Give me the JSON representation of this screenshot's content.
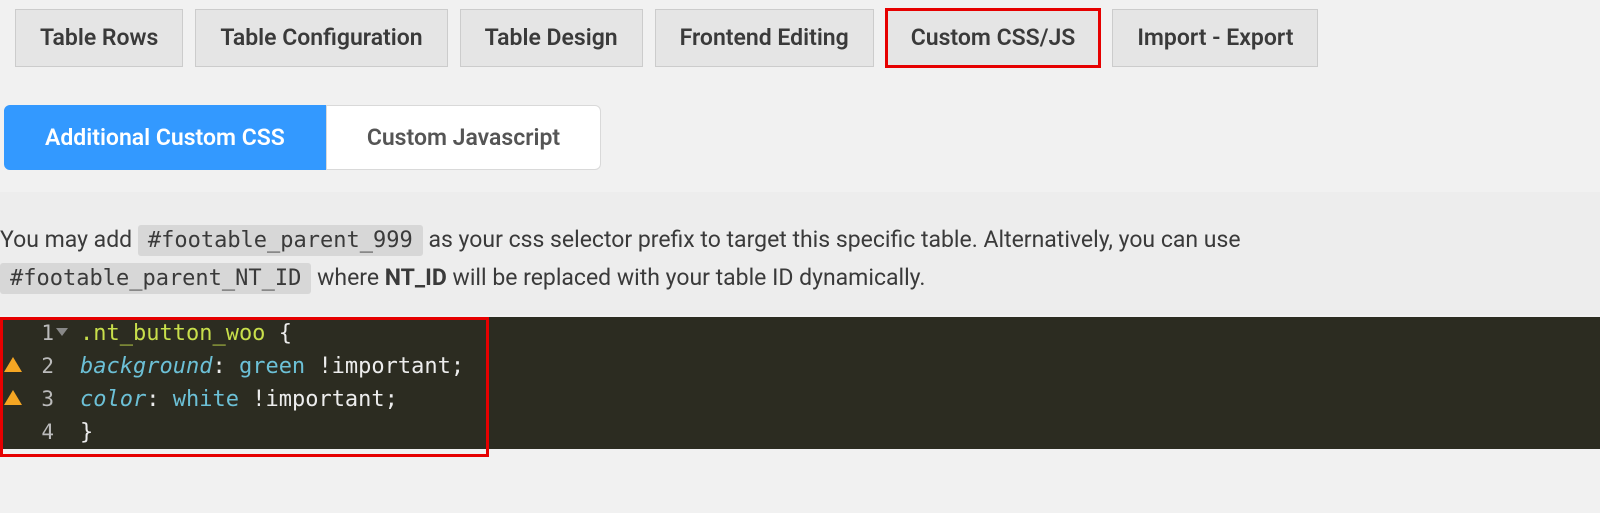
{
  "top_tabs": [
    {
      "label": "Table Rows"
    },
    {
      "label": "Table Configuration"
    },
    {
      "label": "Table Design"
    },
    {
      "label": "Frontend Editing"
    },
    {
      "label": "Custom CSS/JS",
      "highlighted": true
    },
    {
      "label": "Import - Export"
    }
  ],
  "sub_tabs": [
    {
      "label": "Additional Custom CSS",
      "active": true
    },
    {
      "label": "Custom Javascript"
    }
  ],
  "help": {
    "pre1": "You may add ",
    "chip1": "#footable_parent_999",
    "mid1": " as your css selector prefix to target this specific table. Alternatively, you can use",
    "chip2": "#footable_parent_NT_ID",
    "mid2": " where ",
    "bold": "NT_ID",
    "post": " will be replaced with your table ID dynamically."
  },
  "editor": {
    "lines": [
      {
        "num": "1",
        "fold": true,
        "tokens": [
          [
            "selector",
            ".nt_button_woo "
          ],
          [
            "brace",
            "{"
          ]
        ]
      },
      {
        "num": "2",
        "warn": true,
        "tokens": [
          [
            "prop",
            "background"
          ],
          [
            "punct",
            ": "
          ],
          [
            "val",
            "green"
          ],
          [
            "punct",
            " "
          ],
          [
            "important",
            "!important"
          ],
          [
            "punct",
            ";"
          ]
        ]
      },
      {
        "num": "3",
        "warn": true,
        "tokens": [
          [
            "prop",
            "color"
          ],
          [
            "punct",
            ": "
          ],
          [
            "val",
            "white"
          ],
          [
            "punct",
            " "
          ],
          [
            "important",
            "!important"
          ],
          [
            "punct",
            ";"
          ]
        ]
      },
      {
        "num": "4",
        "tokens": [
          [
            "brace",
            "}"
          ]
        ]
      }
    ]
  }
}
